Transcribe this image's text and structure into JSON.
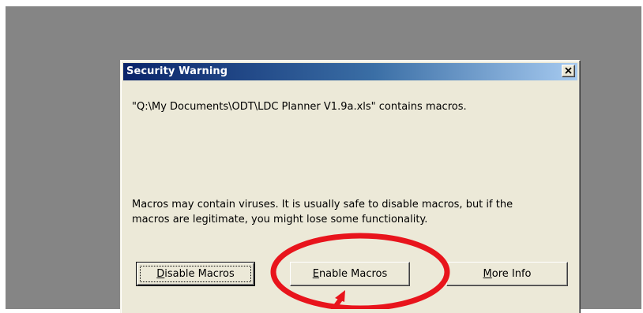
{
  "dialog": {
    "title": "Security Warning",
    "file_message": "\"Q:\\My Documents\\ODT\\LDC Planner V1.9a.xls\" contains macros.",
    "warning_line1": "Macros may contain viruses. It is usually safe to disable macros, but if the",
    "warning_line2": "macros are legitimate, you might lose some functionality.",
    "buttons": {
      "disable": {
        "mnemonic": "D",
        "rest": "isable Macros"
      },
      "enable": {
        "mnemonic": "E",
        "rest": "nable Macros"
      },
      "more": {
        "mnemonic": "M",
        "rest": "ore Info"
      }
    }
  },
  "annotation": {
    "color": "#e8141c",
    "target": "Enable Macros"
  },
  "icons": {
    "close": "close-icon",
    "highlight": "red-circle-highlight",
    "arrow": "red-arrow-pointer"
  }
}
